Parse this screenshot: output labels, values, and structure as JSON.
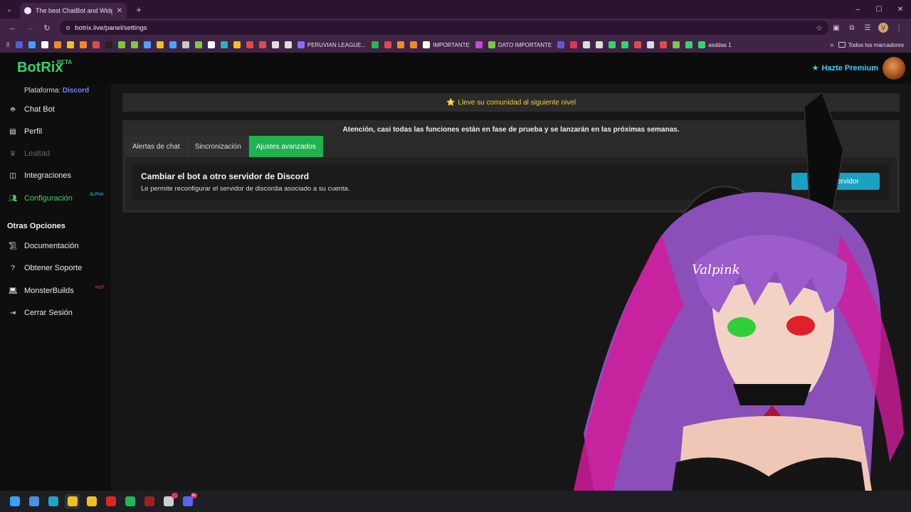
{
  "browser": {
    "tab_menu_icon": "chevron-down-icon",
    "active_tab_title": "The best ChatBot and Widgets",
    "tab_close": "✕",
    "new_tab": "+",
    "url": "botrix.live/panel/settings",
    "profile_initial": "V",
    "window_controls": [
      "–",
      "☐",
      "✕"
    ]
  },
  "bookmarks": {
    "items": [
      {
        "label": "",
        "color": "#5b5bd6"
      },
      {
        "label": "",
        "color": "#3fa0ff"
      },
      {
        "label": "",
        "color": "#ffffff"
      },
      {
        "label": "",
        "color": "#f08a24"
      },
      {
        "label": "",
        "color": "#f0c024"
      },
      {
        "label": "",
        "color": "#f08a24"
      },
      {
        "label": "",
        "color": "#e04a4a"
      },
      {
        "label": "",
        "color": "#222222"
      },
      {
        "label": "",
        "color": "#7ac943"
      },
      {
        "label": "",
        "color": "#7ac943"
      },
      {
        "label": "",
        "color": "#4aa3ff"
      },
      {
        "label": "",
        "color": "#f0c024"
      },
      {
        "label": "",
        "color": "#4aa3ff"
      },
      {
        "label": "",
        "color": "#c8c8c8"
      },
      {
        "label": "",
        "color": "#7ac943"
      },
      {
        "label": "",
        "color": "#ffffff"
      },
      {
        "label": "",
        "color": "#2bb3c0"
      },
      {
        "label": "",
        "color": "#f0c024"
      },
      {
        "label": "",
        "color": "#e04a4a"
      },
      {
        "label": "",
        "color": "#e04a4a"
      },
      {
        "label": "",
        "color": "#dddddd"
      },
      {
        "label": "",
        "color": "#dddddd"
      },
      {
        "label": "PERUVIAN LEAGUE...",
        "color": "#8c6bff"
      },
      {
        "label": "",
        "color": "#2fb24f"
      },
      {
        "label": "",
        "color": "#e04a4a"
      },
      {
        "label": "",
        "color": "#f08a24"
      },
      {
        "label": "",
        "color": "#f08a24"
      },
      {
        "label": "IMPORTANTE",
        "color": "#ffffff"
      },
      {
        "label": "",
        "color": "#c24bd6"
      },
      {
        "label": "DATO IMPORTANTE",
        "color": "#7ac943"
      },
      {
        "label": "",
        "color": "#5b5bd6"
      },
      {
        "label": "",
        "color": "#e0325a"
      },
      {
        "label": "",
        "color": "#dddddd"
      },
      {
        "label": "",
        "color": "#dddddd"
      },
      {
        "label": "",
        "color": "#35d46b"
      },
      {
        "label": "",
        "color": "#35d46b"
      },
      {
        "label": "",
        "color": "#e04a4a"
      },
      {
        "label": "",
        "color": "#dddddd"
      },
      {
        "label": "",
        "color": "#e04a4a"
      },
      {
        "label": "",
        "color": "#7ac943"
      },
      {
        "label": "",
        "color": "#35d46b"
      },
      {
        "label": "asddas 1",
        "color": "#35d46b"
      }
    ],
    "more": "»",
    "all_bookmarks": "Todos los marcadores"
  },
  "site": {
    "logo": "BotRix",
    "logo_badge": "BETA",
    "premium_label": "Hazte Premium",
    "premium_icon": "star-icon"
  },
  "sidebar": {
    "platform_prefix": "Plataforma:",
    "platform_value": "Discord",
    "items": [
      {
        "label": "Chat Bot",
        "icon": "robot-icon"
      },
      {
        "label": "Perfil",
        "icon": "id-card-icon"
      },
      {
        "label": "Lealtad",
        "icon": "trophy-icon"
      },
      {
        "label": "Integraciones",
        "icon": "plug-icon"
      },
      {
        "label": "Configuración",
        "icon": "users-cog-icon"
      }
    ],
    "alpha_badge": "ALPHA",
    "other_heading": "Otras Opciones",
    "other_items": [
      {
        "label": "Documentación",
        "icon": "scroll-icon"
      },
      {
        "label": "Obtener Soporte",
        "icon": "question-icon"
      },
      {
        "label": "MonsterBuilds",
        "icon": "laptop-icon"
      },
      {
        "label": "Cerrar Sesión",
        "icon": "sign-out-icon"
      }
    ],
    "hot_badge": "HOT"
  },
  "main": {
    "banner": "Lleve su comunidad al siguiente nivel",
    "notice": "Atención, casi todas las funciones están en fase de prueba y se lanzarán en las próximas semanas.",
    "tabs": [
      {
        "label": "Alertas de chat"
      },
      {
        "label": "Sincronización"
      },
      {
        "label": "Ajustes avanzados",
        "active": true
      }
    ],
    "card": {
      "title": "Cambiar el bot a otro servidor de Discord",
      "description": "Le permite reconfigurar el servidor de discordia asociado a su cuenta.",
      "button_visible": "cionar servidor"
    }
  },
  "overlay": {
    "signature": "Valpink"
  },
  "taskbar": {
    "apps": [
      {
        "icon": "windows-start-icon",
        "color": "#3aa0ff"
      },
      {
        "icon": "file-explorer-alt-icon",
        "color": "#4a90e2"
      },
      {
        "icon": "edge-icon",
        "color": "#1fa3c8"
      },
      {
        "icon": "chrome-icon",
        "color": "#f0c024",
        "active": true
      },
      {
        "icon": "folder-icon",
        "color": "#f0c024"
      },
      {
        "icon": "youtube-icon",
        "color": "#e02424"
      },
      {
        "icon": "spotify-icon",
        "color": "#1db954"
      },
      {
        "icon": "app-red-icon",
        "color": "#a02020"
      },
      {
        "icon": "steam-clock-icon",
        "color": "#cfcfcf",
        "badge": ""
      },
      {
        "icon": "discord-icon",
        "color": "#5865f2",
        "badge": "9+"
      }
    ]
  },
  "colors": {
    "brand_green": "#35d46b",
    "accent_cyan": "#3fd0f0",
    "button_blue": "#1aa0c2",
    "banner_yellow": "#f5cf3a"
  }
}
